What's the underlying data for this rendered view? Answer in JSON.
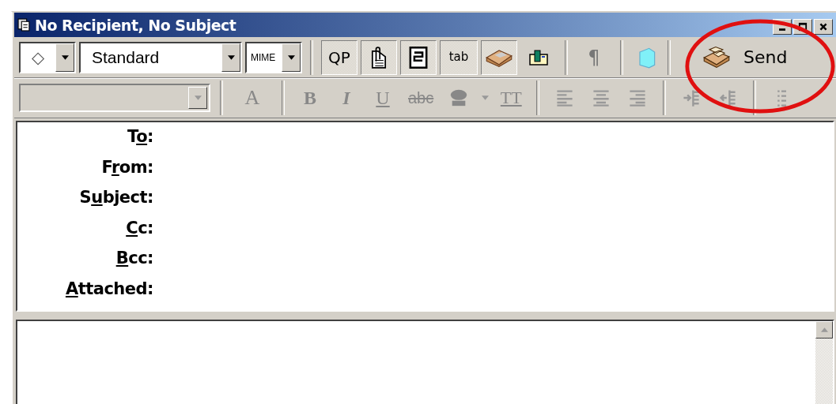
{
  "window": {
    "title": "No Recipient, No Subject"
  },
  "toolbar": {
    "combos": [
      {
        "kind": "symbol",
        "value": "◇"
      },
      {
        "kind": "style",
        "value": "Standard"
      },
      {
        "kind": "encoding",
        "value": "MIME"
      }
    ],
    "buttons": [
      {
        "kind": "text",
        "label": "QP",
        "pressed": true
      },
      {
        "kind": "attach",
        "pressed": true
      },
      {
        "kind": "document",
        "pressed": true
      },
      {
        "kind": "tab",
        "label": "tab",
        "pressed": true
      },
      {
        "kind": "box",
        "pressed": true
      },
      {
        "kind": "card",
        "pressed": false
      },
      {
        "kind": "sep"
      },
      {
        "kind": "text",
        "label": "¶",
        "pressed": false,
        "disabled": true
      },
      {
        "kind": "sep"
      },
      {
        "kind": "cube",
        "pressed": false
      },
      {
        "kind": "sep"
      }
    ],
    "send": {
      "label": "Send"
    }
  },
  "format_bar": {
    "font_combo": {
      "disabled": true
    },
    "buttons": [
      {
        "kind": "sep"
      },
      {
        "kind": "fontsize",
        "label": "A"
      },
      {
        "kind": "sep"
      },
      {
        "kind": "bold",
        "label": "B"
      },
      {
        "kind": "italic",
        "label": "I"
      },
      {
        "kind": "underline",
        "label": "U"
      },
      {
        "kind": "strike",
        "label": "abc"
      },
      {
        "kind": "color"
      },
      {
        "kind": "caret"
      },
      {
        "kind": "tt",
        "label": "TT"
      },
      {
        "kind": "sep"
      },
      {
        "kind": "align-left"
      },
      {
        "kind": "align-center"
      },
      {
        "kind": "align-right"
      },
      {
        "kind": "sep"
      },
      {
        "kind": "indent"
      },
      {
        "kind": "outdent"
      },
      {
        "kind": "sep"
      },
      {
        "kind": "list"
      }
    ]
  },
  "header_fields": [
    {
      "before": "T",
      "key": "o",
      "after": ":"
    },
    {
      "before": "F",
      "key": "r",
      "after": "om:"
    },
    {
      "before": "S",
      "key": "u",
      "after": "bject:"
    },
    {
      "key": "C",
      "after": "c:"
    },
    {
      "key": "B",
      "after": "cc:"
    },
    {
      "key": "A",
      "after": "ttached:"
    }
  ]
}
